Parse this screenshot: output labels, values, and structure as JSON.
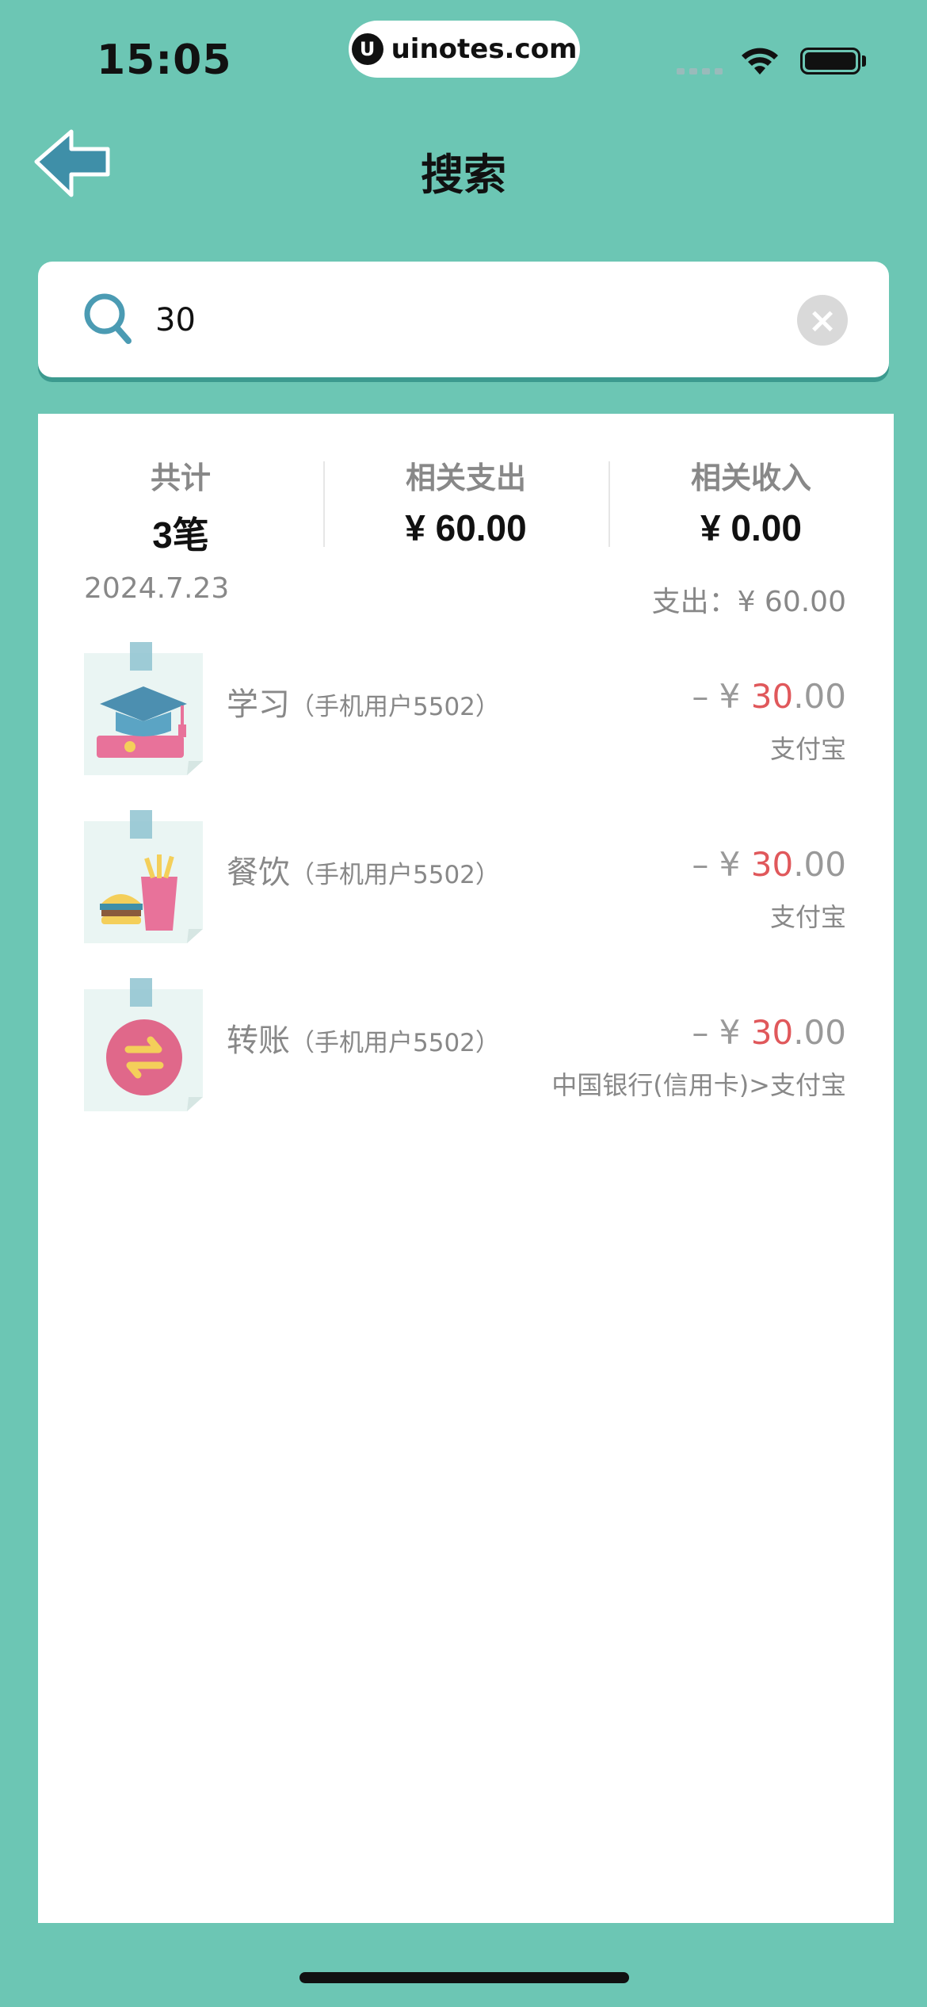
{
  "status_bar": {
    "time": "15:05",
    "url": "uinotes.com",
    "url_logo": "U"
  },
  "header": {
    "title": "搜索"
  },
  "search": {
    "value": "30",
    "placeholder": ""
  },
  "summary": [
    {
      "label": "共计",
      "value": "3笔"
    },
    {
      "label": "相关支出",
      "value": "¥ 60.00"
    },
    {
      "label": "相关收入",
      "value": "¥ 0.00"
    }
  ],
  "day": {
    "date": "2024.7.23",
    "total": "支出：¥ 60.00"
  },
  "transactions": [
    {
      "category": "学习",
      "user": "（手机用户5502）",
      "prefix": "– ¥ ",
      "highlight": "30",
      "suffix": ".00",
      "account": "支付宝",
      "icon": "graduation-cap-icon"
    },
    {
      "category": "餐饮",
      "user": "（手机用户5502）",
      "prefix": "– ¥ ",
      "highlight": "30",
      "suffix": ".00",
      "account": "支付宝",
      "icon": "food-icon"
    },
    {
      "category": "转账",
      "user": "（手机用户5502）",
      "prefix": "– ¥ ",
      "highlight": "30",
      "suffix": ".00",
      "account": "中国银行(信用卡)>支付宝",
      "icon": "transfer-icon"
    }
  ],
  "colors": {
    "background": "#6cc6b4",
    "highlight": "#e0585b",
    "muted": "#888888"
  }
}
